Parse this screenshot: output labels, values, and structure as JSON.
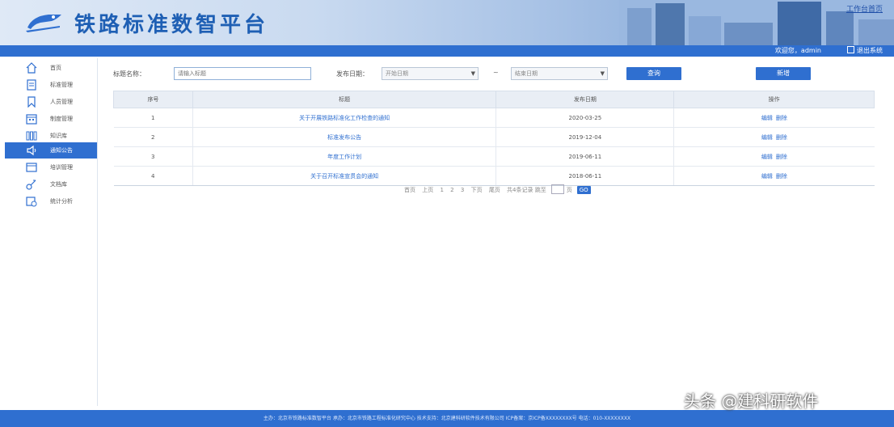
{
  "header": {
    "title": "铁路标准数智平台",
    "top_link": "工作台首页"
  },
  "subbar": {
    "user_info": "欢迎您，admin",
    "logout": "退出系统"
  },
  "sidebar": {
    "items": [
      {
        "label": "首页",
        "icon": "home-icon"
      },
      {
        "label": "标准管理",
        "icon": "document-icon"
      },
      {
        "label": "人员管理",
        "icon": "bookmark-icon"
      },
      {
        "label": "制度管理",
        "icon": "calendar-icon"
      },
      {
        "label": "知识库",
        "icon": "grid-icon"
      },
      {
        "label": "通知公告",
        "icon": "speaker-icon"
      },
      {
        "label": "培训管理",
        "icon": "window-icon"
      },
      {
        "label": "文档库",
        "icon": "link-icon"
      },
      {
        "label": "统计分析",
        "icon": "chart-icon"
      }
    ],
    "active_index": 5
  },
  "filters": {
    "title_label": "标题名称：",
    "title_placeholder": "请输入标题",
    "date_label": "发布日期：",
    "start_placeholder": "开始日期",
    "end_placeholder": "结束日期",
    "dash": "~",
    "query_button": "查询",
    "add_button": "新增"
  },
  "table": {
    "headers": [
      "序号",
      "标题",
      "发布日期",
      "操作"
    ],
    "rows": [
      {
        "no": "1",
        "title": "关于开展铁路标准化工作检查的通知",
        "date": "2020-03-25",
        "ops": [
          "编辑",
          "删除"
        ]
      },
      {
        "no": "2",
        "title": "标准发布公告",
        "date": "2019-12-04",
        "ops": [
          "编辑",
          "删除"
        ]
      },
      {
        "no": "3",
        "title": "年度工作计划",
        "date": "2019-06-11",
        "ops": [
          "编辑",
          "删除"
        ]
      },
      {
        "no": "4",
        "title": "关于召开标准宣贯会的通知",
        "date": "2018-06-11",
        "ops": [
          "编辑",
          "删除"
        ]
      }
    ]
  },
  "pager": {
    "items": [
      "首页",
      "上页",
      "1",
      "2",
      "3",
      "下页",
      "尾页"
    ],
    "summary": "共4条记录 跳至",
    "page_suffix": "页",
    "go": "GO"
  },
  "footer": {
    "text": "主办：北京市铁路标准数智平台   承办：北京市铁路工程标准化研究中心   技术支持：北京建科研软件技术有限公司   ICP备案：京ICP备XXXXXXXX号   电话：010-XXXXXXXX"
  },
  "watermark": "头条 @建科研软件",
  "colors": {
    "primary": "#2f6fd0",
    "header_title": "#1e5fb4",
    "table_header": "#e9eef5"
  }
}
